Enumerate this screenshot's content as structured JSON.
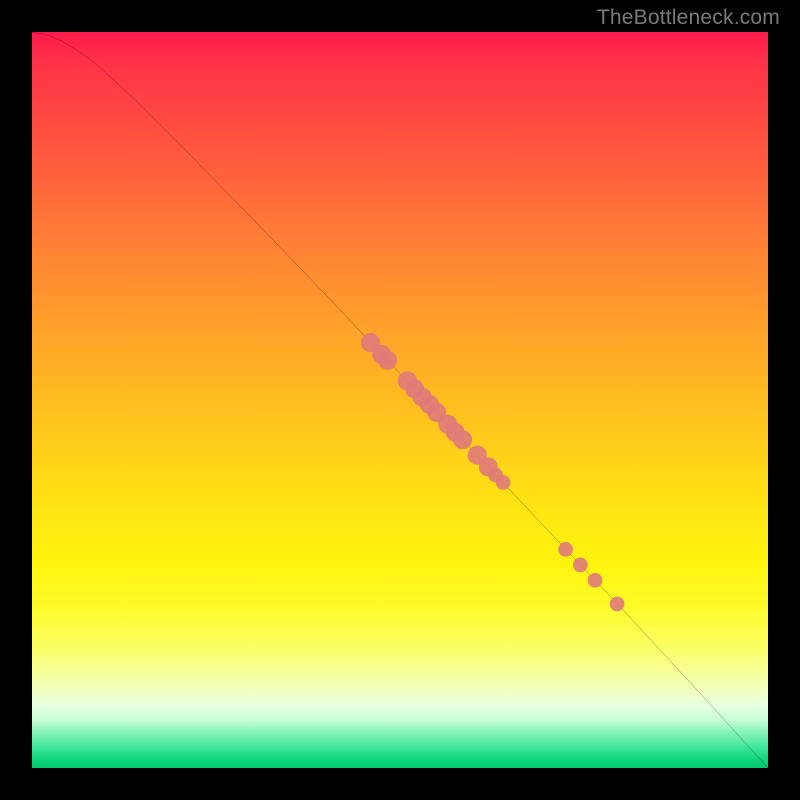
{
  "watermark": "TheBottleneck.com",
  "chart_data": {
    "type": "line",
    "title": "",
    "xlabel": "",
    "ylabel": "",
    "xlim": [
      0,
      100
    ],
    "ylim": [
      0,
      100
    ],
    "gradient_stops": [
      {
        "pos": 0,
        "color": "#ff1a4d"
      },
      {
        "pos": 12,
        "color": "#ff4a42"
      },
      {
        "pos": 32,
        "color": "#ff8a32"
      },
      {
        "pos": 52,
        "color": "#ffc21e"
      },
      {
        "pos": 72,
        "color": "#fff40e"
      },
      {
        "pos": 88,
        "color": "#f0ffb8"
      },
      {
        "pos": 95,
        "color": "#8cf5b8"
      },
      {
        "pos": 100,
        "color": "#00c96b"
      }
    ],
    "curve": [
      {
        "x": 0,
        "y": 100.0
      },
      {
        "x": 2,
        "y": 99.6
      },
      {
        "x": 4,
        "y": 98.8
      },
      {
        "x": 6,
        "y": 97.6
      },
      {
        "x": 8,
        "y": 96.2
      },
      {
        "x": 10,
        "y": 94.5
      },
      {
        "x": 14,
        "y": 90.8
      },
      {
        "x": 20,
        "y": 84.8
      },
      {
        "x": 30,
        "y": 74.6
      },
      {
        "x": 40,
        "y": 64.2
      },
      {
        "x": 50,
        "y": 53.6
      },
      {
        "x": 60,
        "y": 43.0
      },
      {
        "x": 70,
        "y": 32.4
      },
      {
        "x": 80,
        "y": 21.8
      },
      {
        "x": 90,
        "y": 11.0
      },
      {
        "x": 100,
        "y": 0.0
      }
    ],
    "highlight_points": [
      {
        "x": 46.0,
        "y": 57.8,
        "r": 1.3
      },
      {
        "x": 47.5,
        "y": 56.2,
        "r": 1.3
      },
      {
        "x": 48.3,
        "y": 55.4,
        "r": 1.3
      },
      {
        "x": 51.0,
        "y": 52.6,
        "r": 1.3
      },
      {
        "x": 52.0,
        "y": 51.5,
        "r": 1.3
      },
      {
        "x": 53.0,
        "y": 50.4,
        "r": 1.3
      },
      {
        "x": 54.0,
        "y": 49.4,
        "r": 1.3
      },
      {
        "x": 55.0,
        "y": 48.3,
        "r": 1.3
      },
      {
        "x": 56.5,
        "y": 46.7,
        "r": 1.3
      },
      {
        "x": 57.5,
        "y": 45.6,
        "r": 1.3
      },
      {
        "x": 58.5,
        "y": 44.6,
        "r": 1.3
      },
      {
        "x": 60.5,
        "y": 42.5,
        "r": 1.3
      },
      {
        "x": 62.0,
        "y": 40.9,
        "r": 1.3
      },
      {
        "x": 63.0,
        "y": 39.8,
        "r": 1.0
      },
      {
        "x": 64.0,
        "y": 38.8,
        "r": 1.0
      },
      {
        "x": 72.5,
        "y": 29.7,
        "r": 1.0
      },
      {
        "x": 74.5,
        "y": 27.6,
        "r": 1.0
      },
      {
        "x": 76.5,
        "y": 25.5,
        "r": 1.0
      },
      {
        "x": 79.5,
        "y": 22.3,
        "r": 1.0
      }
    ]
  }
}
